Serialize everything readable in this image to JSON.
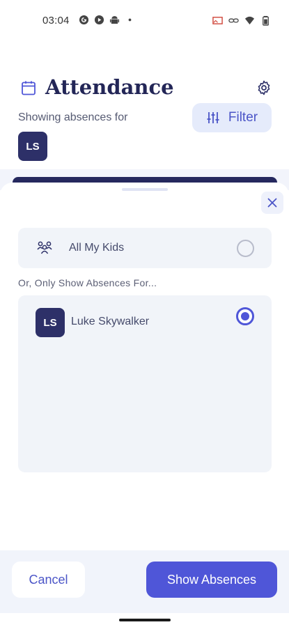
{
  "status_bar": {
    "time": "03:04",
    "left_icons": [
      "g-circle-icon",
      "play-circle-icon",
      "android-icon",
      "dot-icon"
    ],
    "right_icons": [
      "cast-icon",
      "link-icon",
      "wifi-icon",
      "battery-icon"
    ]
  },
  "header": {
    "title": "Attendance",
    "showing_label": "Showing absences for",
    "filter_label": "Filter",
    "student_initials": "LS"
  },
  "sheet": {
    "all_kids_label": "All My Kids",
    "all_kids_selected": false,
    "or_label": "Or, Only Show Absences For...",
    "kids": [
      {
        "initials": "LS",
        "name": "Luke Skywalker",
        "selected": true
      }
    ]
  },
  "footer": {
    "cancel_label": "Cancel",
    "show_label": "Show Absences"
  },
  "colors": {
    "primary": "#4f56d8",
    "navy": "#2d3068",
    "title": "#232657",
    "panel_bg": "#f1f4f9",
    "filter_bg": "#e5ebfb"
  }
}
